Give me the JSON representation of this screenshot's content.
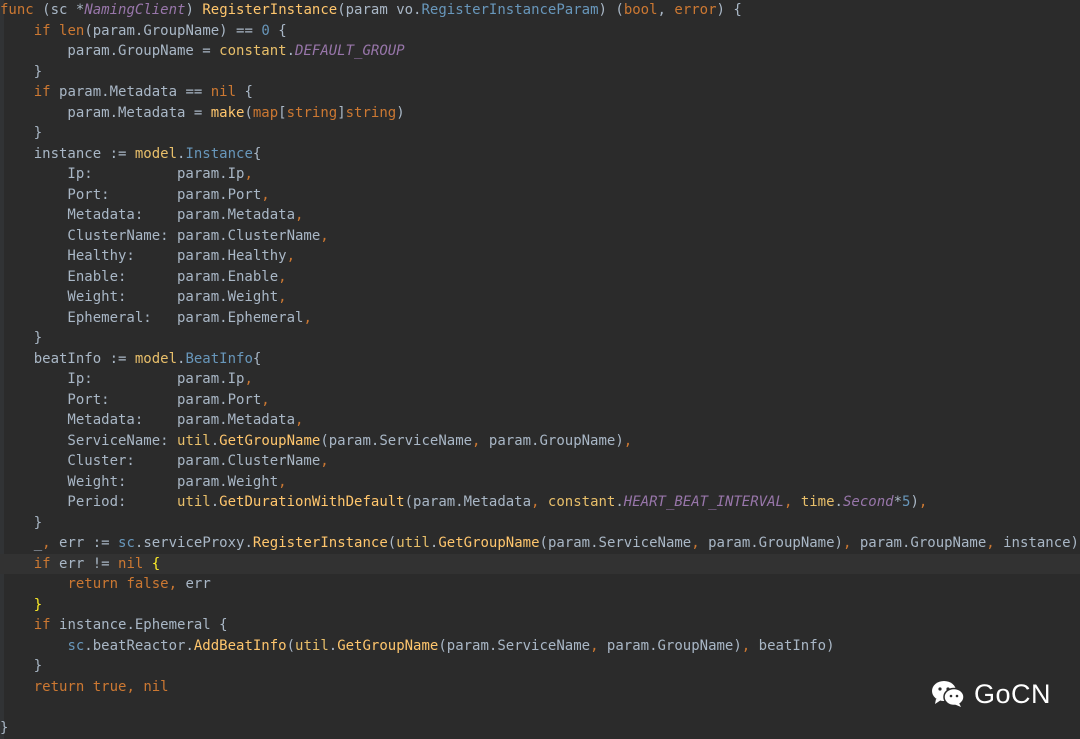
{
  "editor": {
    "lines": [
      [
        [
          "t-kw",
          "func "
        ],
        [
          "t-pl",
          "("
        ],
        [
          "t-id",
          "sc "
        ],
        [
          "t-pl",
          "*"
        ],
        [
          "t-ct",
          "NamingClient"
        ],
        [
          "t-pl",
          ") "
        ],
        [
          "t-fn",
          "RegisterInstance"
        ],
        [
          "t-pl",
          "(param vo."
        ],
        [
          "t-type",
          "RegisterInstanceParam"
        ],
        [
          "t-pl",
          ") ("
        ],
        [
          "t-kw",
          "bool"
        ],
        [
          "t-pl",
          ", "
        ],
        [
          "t-kw",
          "error"
        ],
        [
          "t-pl",
          ") {"
        ]
      ],
      [
        [
          "t-pl",
          "    "
        ],
        [
          "t-kw",
          "if "
        ],
        [
          "t-bi",
          "len"
        ],
        [
          "t-pl",
          "(param.GroupName) == "
        ],
        [
          "t-num",
          "0"
        ],
        [
          "t-pl",
          " {"
        ]
      ],
      [
        [
          "t-pl",
          "        param.GroupName = "
        ],
        [
          "t-pkg",
          "constant"
        ],
        [
          "t-pl",
          "."
        ],
        [
          "t-const",
          "DEFAULT_GROUP"
        ]
      ],
      [
        [
          "t-pl",
          "    }"
        ]
      ],
      [
        [
          "t-pl",
          "    "
        ],
        [
          "t-kw",
          "if "
        ],
        [
          "t-pl",
          "param.Metadata == "
        ],
        [
          "t-kw",
          "nil"
        ],
        [
          "t-pl",
          " {"
        ]
      ],
      [
        [
          "t-pl",
          "        param.Metadata = "
        ],
        [
          "t-fn",
          "make"
        ],
        [
          "t-pl",
          "("
        ],
        [
          "t-kw",
          "map"
        ],
        [
          "t-pl",
          "["
        ],
        [
          "t-kw",
          "string"
        ],
        [
          "t-pl",
          "]"
        ],
        [
          "t-kw",
          "string"
        ],
        [
          "t-pl",
          ")"
        ]
      ],
      [
        [
          "t-pl",
          "    }"
        ]
      ],
      [
        [
          "t-pl",
          "    instance := "
        ],
        [
          "t-pkg",
          "model"
        ],
        [
          "t-pl",
          "."
        ],
        [
          "t-type",
          "Instance"
        ],
        [
          "t-pl",
          "{"
        ]
      ],
      [
        [
          "t-pl",
          "        Ip:          param.Ip"
        ],
        [
          "t-kw",
          ","
        ]
      ],
      [
        [
          "t-pl",
          "        Port:        param.Port"
        ],
        [
          "t-kw",
          ","
        ]
      ],
      [
        [
          "t-pl",
          "        Metadata:    param.Metadata"
        ],
        [
          "t-kw",
          ","
        ]
      ],
      [
        [
          "t-pl",
          "        ClusterName: param.ClusterName"
        ],
        [
          "t-kw",
          ","
        ]
      ],
      [
        [
          "t-pl",
          "        Healthy:     param.Healthy"
        ],
        [
          "t-kw",
          ","
        ]
      ],
      [
        [
          "t-pl",
          "        Enable:      param.Enable"
        ],
        [
          "t-kw",
          ","
        ]
      ],
      [
        [
          "t-pl",
          "        Weight:      param.Weight"
        ],
        [
          "t-kw",
          ","
        ]
      ],
      [
        [
          "t-pl",
          "        Ephemeral:   param.Ephemeral"
        ],
        [
          "t-kw",
          ","
        ]
      ],
      [
        [
          "t-pl",
          "    }"
        ]
      ],
      [
        [
          "t-pl",
          "    beatInfo := "
        ],
        [
          "t-pkg",
          "model"
        ],
        [
          "t-pl",
          "."
        ],
        [
          "t-type",
          "BeatInfo"
        ],
        [
          "t-pl",
          "{"
        ]
      ],
      [
        [
          "t-pl",
          "        Ip:          param.Ip"
        ],
        [
          "t-kw",
          ","
        ]
      ],
      [
        [
          "t-pl",
          "        Port:        param.Port"
        ],
        [
          "t-kw",
          ","
        ]
      ],
      [
        [
          "t-pl",
          "        Metadata:    param.Metadata"
        ],
        [
          "t-kw",
          ","
        ]
      ],
      [
        [
          "t-pl",
          "        ServiceName: "
        ],
        [
          "t-pkg",
          "util"
        ],
        [
          "t-pl",
          "."
        ],
        [
          "t-fn",
          "GetGroupName"
        ],
        [
          "t-pl",
          "(param.ServiceName"
        ],
        [
          "t-kw",
          ","
        ],
        [
          "t-pl",
          " param.GroupName)"
        ],
        [
          "t-kw",
          ","
        ]
      ],
      [
        [
          "t-pl",
          "        Cluster:     param.ClusterName"
        ],
        [
          "t-kw",
          ","
        ]
      ],
      [
        [
          "t-pl",
          "        Weight:      param.Weight"
        ],
        [
          "t-kw",
          ","
        ]
      ],
      [
        [
          "t-pl",
          "        Period:      "
        ],
        [
          "t-pkg",
          "util"
        ],
        [
          "t-pl",
          "."
        ],
        [
          "t-fn",
          "GetDurationWithDefault"
        ],
        [
          "t-pl",
          "(param.Metadata"
        ],
        [
          "t-kw",
          ","
        ],
        [
          "t-pl",
          " "
        ],
        [
          "t-pkg",
          "constant"
        ],
        [
          "t-pl",
          "."
        ],
        [
          "t-const",
          "HEART_BEAT_INTERVAL"
        ],
        [
          "t-kw",
          ","
        ],
        [
          "t-pl",
          " "
        ],
        [
          "t-pkg",
          "time"
        ],
        [
          "t-pl",
          "."
        ],
        [
          "t-const",
          "Second"
        ],
        [
          "t-pl",
          "*"
        ],
        [
          "t-num",
          "5"
        ],
        [
          "t-pl",
          ")"
        ],
        [
          "t-kw",
          ","
        ]
      ],
      [
        [
          "t-pl",
          "    }"
        ]
      ],
      [
        [
          "t-pl",
          "    _"
        ],
        [
          "t-kw",
          ","
        ],
        [
          "t-pl",
          " err := "
        ],
        [
          "t-type",
          "sc"
        ],
        [
          "t-pl",
          ".serviceProxy."
        ],
        [
          "t-fn",
          "RegisterInstance"
        ],
        [
          "t-pl",
          "("
        ],
        [
          "t-pkg",
          "util"
        ],
        [
          "t-pl",
          "."
        ],
        [
          "t-fn",
          "GetGroupName"
        ],
        [
          "t-pl",
          "(param.ServiceName"
        ],
        [
          "t-kw",
          ","
        ],
        [
          "t-pl",
          " param.GroupName)"
        ],
        [
          "t-kw",
          ","
        ],
        [
          "t-pl",
          " param.GroupName"
        ],
        [
          "t-kw",
          ","
        ],
        [
          "t-pl",
          " instance)"
        ]
      ],
      [
        [
          "t-pl",
          "    "
        ],
        [
          "t-kw",
          "if "
        ],
        [
          "t-pl",
          "err != "
        ],
        [
          "t-kw",
          "nil "
        ],
        [
          "t-bm",
          "{"
        ]
      ],
      [
        [
          "t-pl",
          "        "
        ],
        [
          "t-kw",
          "return false"
        ],
        [
          "t-kw",
          ","
        ],
        [
          "t-pl",
          " err"
        ]
      ],
      [
        [
          "t-pl",
          "    "
        ],
        [
          "t-bm",
          "}"
        ]
      ],
      [
        [
          "t-pl",
          "    "
        ],
        [
          "t-kw",
          "if "
        ],
        [
          "t-pl",
          "instance.Ephemeral {"
        ]
      ],
      [
        [
          "t-pl",
          "        "
        ],
        [
          "t-type",
          "sc"
        ],
        [
          "t-pl",
          ".beatReactor."
        ],
        [
          "t-fn",
          "AddBeatInfo"
        ],
        [
          "t-pl",
          "("
        ],
        [
          "t-pkg",
          "util"
        ],
        [
          "t-pl",
          "."
        ],
        [
          "t-fn",
          "GetGroupName"
        ],
        [
          "t-pl",
          "(param.ServiceName"
        ],
        [
          "t-kw",
          ","
        ],
        [
          "t-pl",
          " param.GroupName)"
        ],
        [
          "t-kw",
          ","
        ],
        [
          "t-pl",
          " beatInfo)"
        ]
      ],
      [
        [
          "t-pl",
          "    }"
        ]
      ],
      [
        [
          "t-pl",
          "    "
        ],
        [
          "t-kw",
          "return true"
        ],
        [
          "t-kw",
          ","
        ],
        [
          "t-pl",
          " "
        ],
        [
          "t-kw",
          "nil"
        ]
      ],
      [
        [
          "t-pl",
          ""
        ]
      ],
      [
        [
          "t-pl",
          "}"
        ]
      ]
    ],
    "current_line_index": 27
  },
  "watermark": {
    "icon": "wechat-icon",
    "text": "GoCN"
  }
}
